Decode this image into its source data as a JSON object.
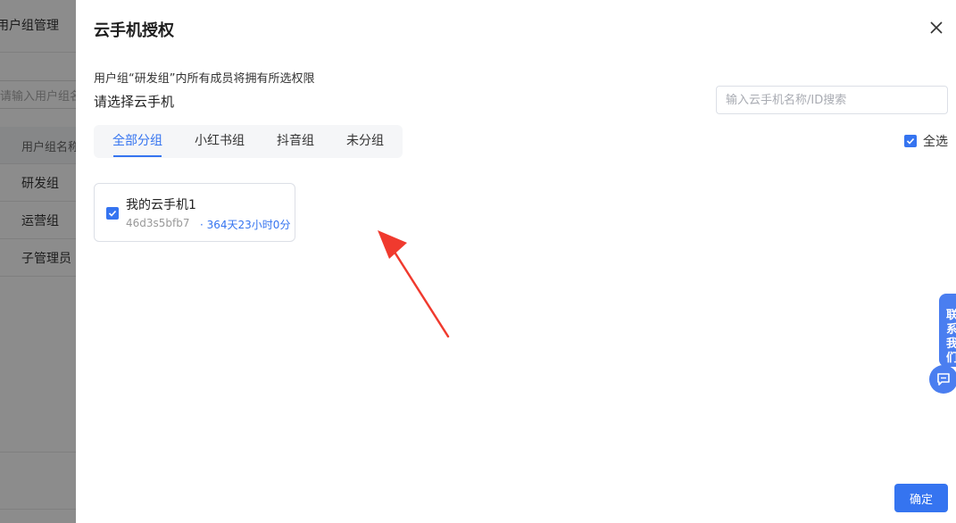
{
  "background": {
    "title": "用户组管理",
    "search_placeholder": "请输入用户组名称",
    "table_header": "用户组名称",
    "rows": [
      "研发组",
      "运营组",
      "子管理员"
    ]
  },
  "drawer": {
    "title": "云手机授权",
    "hint": "用户组“研发组”内所有成员将拥有所选权限",
    "subtitle": "请选择云手机",
    "search_placeholder": "输入云手机名称/ID搜索",
    "tabs": [
      {
        "label": "全部分组",
        "active": true
      },
      {
        "label": "小红书组",
        "active": false
      },
      {
        "label": "抖音组",
        "active": false
      },
      {
        "label": "未分组",
        "active": false
      }
    ],
    "select_all_label": "全选",
    "phones": [
      {
        "name": "我的云手机1",
        "id": "46d3s5bfb7",
        "remaining": "· 364天23小时0分",
        "checked": true
      }
    ],
    "confirm_label": "确定"
  },
  "floating": {
    "contact_label": "联系我们"
  },
  "colors": {
    "accent": "#3574f0",
    "annotation_arrow": "#f03a2e",
    "float_button": "#4a7ef0"
  }
}
